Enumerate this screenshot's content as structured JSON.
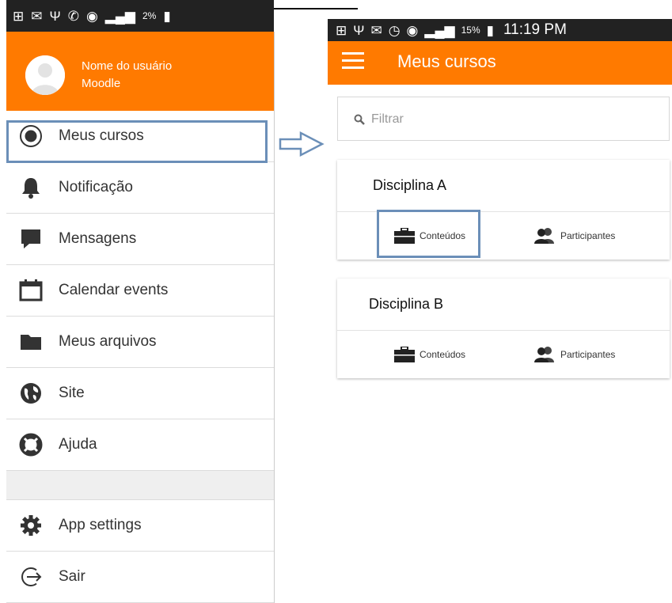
{
  "left": {
    "status_bar": {
      "battery": "2%"
    },
    "user": {
      "name": "Nome do usuário",
      "site": "Moodle"
    },
    "menu": [
      {
        "label": "Meus cursos",
        "icon": "radio-target-icon"
      },
      {
        "label": "Notificação",
        "icon": "bell-icon"
      },
      {
        "label": "Mensagens",
        "icon": "chat-bubble-icon"
      },
      {
        "label": "Calendar events",
        "icon": "calendar-icon"
      },
      {
        "label": "Meus arquivos",
        "icon": "folder-icon"
      },
      {
        "label": "Site",
        "icon": "globe-icon"
      },
      {
        "label": "Ajuda",
        "icon": "lifebuoy-icon"
      },
      {
        "label": "App settings",
        "icon": "gear-icon"
      },
      {
        "label": "Sair",
        "icon": "logout-icon"
      }
    ]
  },
  "right": {
    "status_bar": {
      "battery": "15%",
      "time": "11:19 PM"
    },
    "app_title": "Meus cursos",
    "search_placeholder": "Filtrar",
    "courses": [
      {
        "title": "Disciplina A",
        "contents_label": "Conteúdos",
        "participants_label": "Participantes"
      },
      {
        "title": "Disciplina B",
        "contents_label": "Conteúdos",
        "participants_label": "Participantes"
      }
    ]
  },
  "colors": {
    "accent": "#ff7a00",
    "highlight": "#6b8fb8",
    "statusbar": "#222222"
  }
}
